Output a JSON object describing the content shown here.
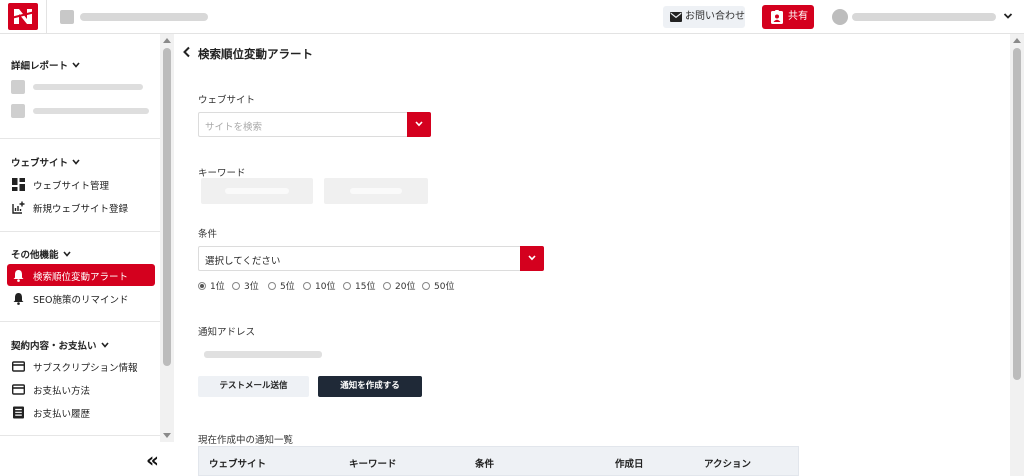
{
  "topbar": {
    "logo_icon": "brand-logo-icon",
    "site_name": "",
    "contact_label": "お問い合わせ",
    "share_label": "共有",
    "account_email": "",
    "accent_color": "#d4001e"
  },
  "sidebar": {
    "sections": [
      {
        "heading": "詳細レポート"
      },
      {
        "heading": "ウェブサイト"
      },
      {
        "heading": "その他機能"
      },
      {
        "heading": "契約内容・お支払い"
      }
    ],
    "report_sites": [
      "",
      ""
    ],
    "website_items": [
      {
        "label": "ウェブサイト管理",
        "icon": "dashboard-icon"
      },
      {
        "label": "新規ウェブサイト登録",
        "icon": "add-chart-icon"
      }
    ],
    "other_items": [
      {
        "label": "検索順位変動アラート",
        "icon": "bell-icon",
        "active": true
      },
      {
        "label": "SEO施策のリマインド",
        "icon": "bell-icon",
        "active": false
      }
    ],
    "billing_items": [
      {
        "label": "サブスクリプション情報",
        "icon": "card-icon"
      },
      {
        "label": "お支払い方法",
        "icon": "card-icon"
      },
      {
        "label": "お支払い履歴",
        "icon": "receipt-icon"
      }
    ],
    "collapse_icon": "double-chevron-left-icon"
  },
  "main": {
    "title": "検索順位変動アラート",
    "website": {
      "label": "ウェブサイト",
      "placeholder": "サイトを検索"
    },
    "keyword": {
      "label": "キーワード",
      "buttons": [
        "",
        ""
      ]
    },
    "condition": {
      "label": "条件",
      "selected": "選択してください",
      "options": [
        "1位",
        "3位",
        "5位",
        "10位",
        "15位",
        "20位",
        "50位"
      ],
      "checked_index": 0
    },
    "notify": {
      "label": "通知アドレス",
      "address": "",
      "test_button": "テストメール送信",
      "create_button": "通知を作成する"
    },
    "list": {
      "title": "現在作成中の通知一覧",
      "columns": [
        "ウェブサイト",
        "キーワード",
        "条件",
        "作成日",
        "アクション"
      ]
    }
  }
}
